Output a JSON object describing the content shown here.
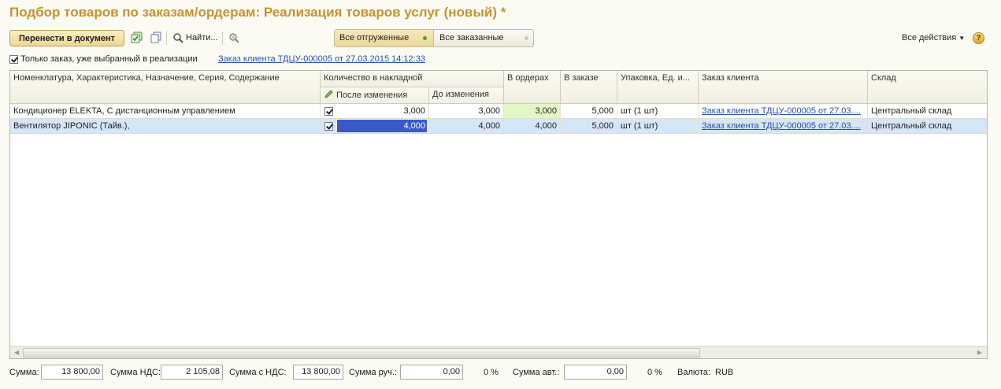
{
  "title": "Подбор товаров по заказам/ордерам: Реализация товаров услуг (новый) *",
  "toolbar": {
    "transfer_button": "Перенести в документ",
    "find_button": "Найти...",
    "segment_shipped": "Все отгруженные",
    "segment_ordered": "Все заказанные",
    "all_actions": "Все действия",
    "help": "?"
  },
  "filter": {
    "only_order_label": "Только заказ, уже выбранный в реализации",
    "only_order_checked": true,
    "order_link": "Заказ клиента ТДЦУ-000005 от 27.03.2015 14:12:33"
  },
  "table": {
    "headers": {
      "nomenclature": "Номенклатура, Характеристика, Назначение, Серия, Содержание",
      "qty_group": "Количество в накладной",
      "after_change": "После изменения",
      "before_change": "До изменения",
      "in_orders": "В ордерах",
      "in_order": "В заказе",
      "packaging": "Упаковка, Ед. и...",
      "client_order": "Заказ клиента",
      "warehouse": "Склад"
    },
    "rows": [
      {
        "name": "Кондиционер ELEKTA, С дистанционным управлением",
        "checked": true,
        "after": "3,000",
        "before": "3,000",
        "in_orders": "3,000",
        "in_order": "5,000",
        "unit": "шт (1 шт)",
        "order": "Заказ клиента ТДЦУ-000005 от 27.03....",
        "warehouse": "Центральный склад"
      },
      {
        "name": "Вентилятор JIPONIC (Тайв.),",
        "checked": true,
        "after": "4,000",
        "before": "4,000",
        "in_orders": "4,000",
        "in_order": "5,000",
        "unit": "шт (1 шт)",
        "order": "Заказ клиента ТДЦУ-000005 от 27.03....",
        "warehouse": "Центральный склад"
      }
    ]
  },
  "footer": {
    "sum_label": "Сумма:",
    "sum_value": "13 800,00",
    "vat_label": "Сумма НДС:",
    "vat_value": "2 105,08",
    "with_vat_label": "Сумма с НДС:",
    "with_vat_value": "13 800,00",
    "manual_label": "Сумма руч.:",
    "manual_value": "0,00",
    "manual_pct": "0 %",
    "auto_label": "Сумма авт.:",
    "auto_value": "0,00",
    "auto_pct": "0 %",
    "currency_label": "Валюта:",
    "currency_value": "RUB"
  }
}
